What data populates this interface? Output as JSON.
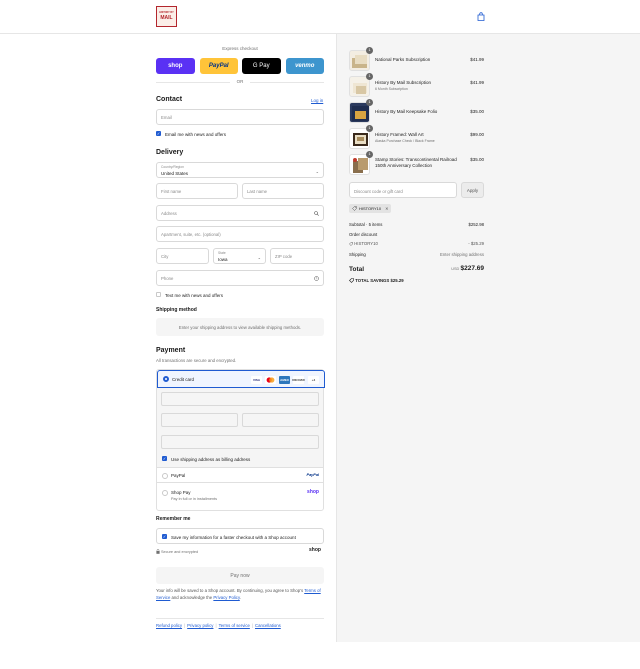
{
  "header": {
    "logo_lines": [
      "HISTORY BY",
      "MAIL"
    ],
    "cart_icon": "shopping-bag-icon"
  },
  "express": {
    "label": "Express checkout",
    "buttons": [
      "shop",
      "PayPal",
      "G Pay",
      "venmo"
    ],
    "or": "OR"
  },
  "contact": {
    "title": "Contact",
    "login": "Log in",
    "email_placeholder": "Email",
    "newsletter": "Email me with news and offers"
  },
  "delivery": {
    "title": "Delivery",
    "country_label": "Country/Region",
    "country_value": "United States",
    "first_name": "First name",
    "last_name": "Last name",
    "address": "Address",
    "apartment": "Apartment, suite, etc. (optional)",
    "city": "City",
    "state_label": "State",
    "state_value": "Iowa",
    "zip": "ZIP code",
    "phone": "Phone",
    "text_me": "Text me with news and offers"
  },
  "shipping": {
    "title": "Shipping method",
    "notice": "Enter your shipping address to view available shipping methods."
  },
  "payment": {
    "title": "Payment",
    "subtitle": "All transactions are secure and encrypted.",
    "credit_card": "Credit card",
    "card_logos": [
      "VISA",
      "MC",
      "AMEX",
      "DISCOVER",
      "+4"
    ],
    "billing_same": "Use shipping address as billing address",
    "paypal": "PayPal",
    "paypal_logo": "PayPal",
    "shop_pay": "Shop Pay",
    "shop_pay_sub": "Pay in full or in installments",
    "shop_pay_logo": "shop"
  },
  "remember": {
    "title": "Remember me",
    "save_info": "Save my information for a faster checkout with a Shop account",
    "secure": "Secure and encrypted",
    "shop_logo": "shop"
  },
  "pay_now": "Pay now",
  "fine_print": {
    "before": "Your info will be saved to a Shop account. By continuing, you agree to Shop's",
    "terms": "Terms of Service",
    "middle": "and acknowledge the",
    "privacy": "Privacy Policy",
    "end": "."
  },
  "footer": [
    "Refund policy",
    "Privacy policy",
    "Terms of service",
    "Cancellations"
  ],
  "order": {
    "items": [
      {
        "name": "National Parks Subscription",
        "sub": "",
        "price": "$41.99",
        "qty": "1"
      },
      {
        "name": "History By Mail Subscription",
        "sub": "6 Month Subscription",
        "price": "$41.99",
        "qty": "1"
      },
      {
        "name": "History By Mail Keepsake Folio",
        "sub": "",
        "price": "$35.00",
        "qty": "1"
      },
      {
        "name": "History Framed: Wall Art",
        "sub": "Alaska Purchase Check / Black Frame",
        "price": "$99.00",
        "qty": "1"
      },
      {
        "name": "Stamp Stories: Transcontinental Railroad 150th Anniversary Collection",
        "sub": "",
        "price": "$35.00",
        "qty": "1"
      }
    ],
    "discount_placeholder": "Discount code or gift card",
    "apply": "Apply",
    "applied_code": "HISTORY10",
    "subtotal_label": "Subtotal · 5 items",
    "subtotal": "$252.98",
    "order_discount": "Order discount",
    "discount_code": "HISTORY10",
    "discount_amount": "- $25.29",
    "shipping_label": "Shipping",
    "shipping_value": "Enter shipping address",
    "total_label": "Total",
    "currency": "USD",
    "total": "$227.69",
    "savings_label": "TOTAL SAVINGS",
    "savings": "$25.29"
  }
}
